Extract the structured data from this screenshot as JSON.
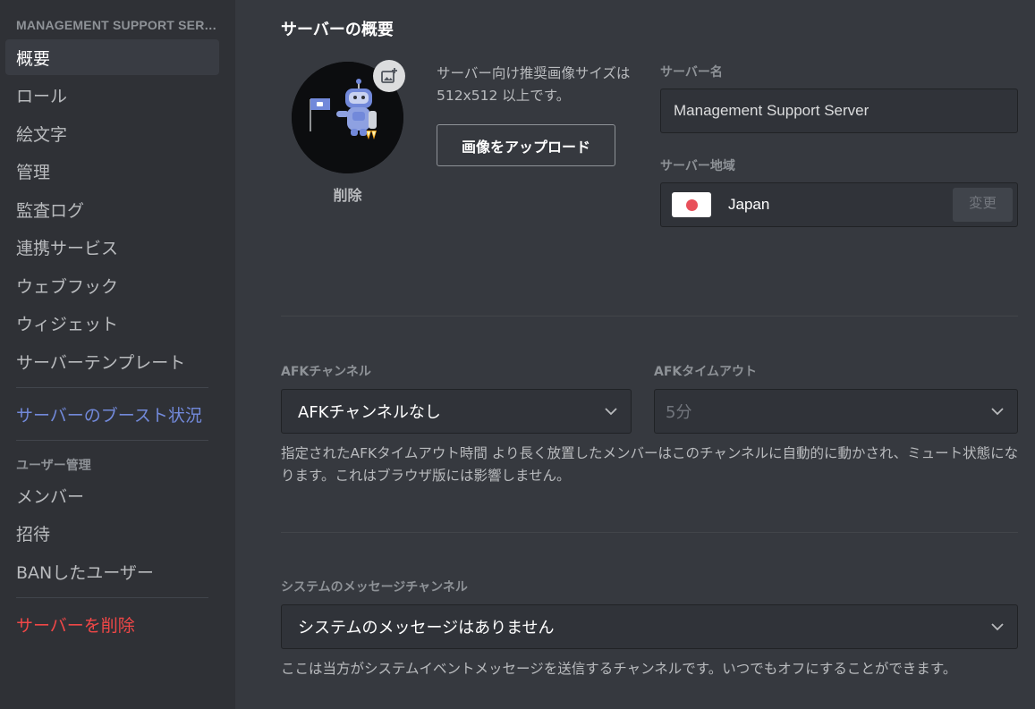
{
  "sidebar": {
    "header": "MANAGEMENT SUPPORT SERVER",
    "items": [
      {
        "label": "概要"
      },
      {
        "label": "ロール"
      },
      {
        "label": "絵文字"
      },
      {
        "label": "管理"
      },
      {
        "label": "監査ログ"
      },
      {
        "label": "連携サービス"
      },
      {
        "label": "ウェブフック"
      },
      {
        "label": "ウィジェット"
      },
      {
        "label": "サーバーテンプレート"
      }
    ],
    "boost_label": "サーバーのブースト状況",
    "user_mgmt_category": "ユーザー管理",
    "user_items": [
      {
        "label": "メンバー"
      },
      {
        "label": "招待"
      },
      {
        "label": "BANしたユーザー"
      }
    ],
    "delete_label": "サーバーを削除"
  },
  "overview": {
    "title": "サーバーの概要",
    "icon": {
      "remove_label": "削除",
      "upload_badge_icon": "add-image-icon",
      "hint": "サーバー向け推奨画像サイズは512x512 以上です。",
      "upload_button": "画像をアップロード"
    },
    "server_name": {
      "label": "サーバー名",
      "value": "Management Support Server"
    },
    "region": {
      "label": "サーバー地域",
      "value": "Japan",
      "flag": "japan-flag",
      "change_button": "変更"
    }
  },
  "afk": {
    "channel_label": "AFKチャンネル",
    "channel_value": "AFKチャンネルなし",
    "timeout_label": "AFKタイムアウト",
    "timeout_value": "5分",
    "description": "指定されたAFKタイムアウト時間 より長く放置したメンバーはこのチャンネルに自動的に動かされ、ミュート状態になります。これはブラウザ版には影響しません。"
  },
  "system_messages": {
    "label": "システムのメッセージチャンネル",
    "value": "システムのメッセージはありません",
    "description": "ここは当方がシステムイベントメッセージを送信するチャンネルです。いつでもオフにすることができます。"
  },
  "colors": {
    "sidebar_bg": "#2f3136",
    "content_bg": "#36393f",
    "accent_blurple": "#7289da",
    "danger_red": "#f04747",
    "input_bg": "#303339"
  }
}
